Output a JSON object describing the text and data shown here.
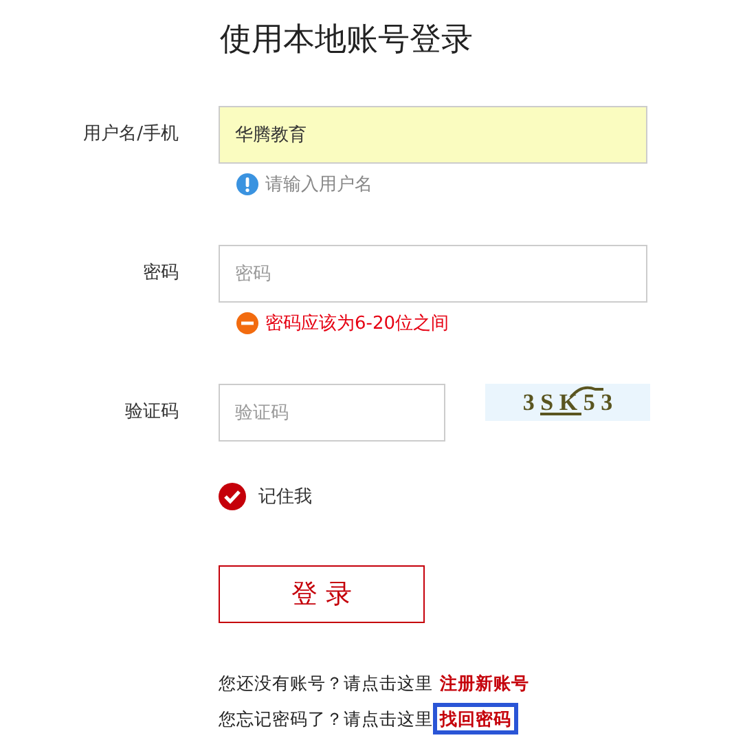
{
  "title": "使用本地账号登录",
  "fields": [
    {
      "label": "用户名/手机",
      "value": "华腾教育",
      "kind": "text",
      "autofilled": true,
      "message": {
        "kind": "info",
        "text": "请输入用户名"
      }
    },
    {
      "label": "密码",
      "placeholder": "密码",
      "kind": "password",
      "autofilled": false,
      "message": {
        "kind": "error",
        "text": "密码应该为6-20位之间"
      }
    },
    {
      "label": "验证码",
      "placeholder": "验证码",
      "kind": "captcha",
      "autofilled": false,
      "captcha": "3 S K 5 3"
    }
  ],
  "remember": {
    "label": "记住我",
    "checked": true
  },
  "login_button": "登 录",
  "links": [
    {
      "text": "您还没有账号？请点击这里",
      "link": "注册新账号",
      "focused": false
    },
    {
      "text": "您忘记密码了？请点击这里",
      "link": "找回密码",
      "focused": true
    }
  ]
}
